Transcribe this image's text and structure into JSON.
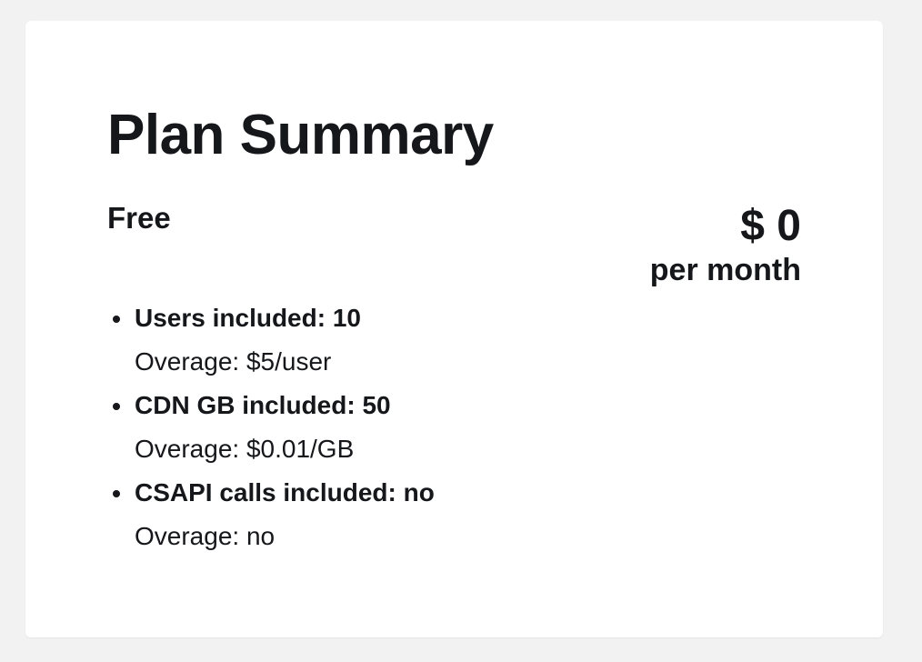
{
  "plan_summary": {
    "title": "Plan Summary",
    "plan_name": "Free",
    "price": {
      "amount": "$ 0",
      "period": "per month"
    },
    "features": [
      {
        "label": "Users included: 10",
        "overage": "Overage: $5/user"
      },
      {
        "label": "CDN GB included: 50",
        "overage": "Overage: $0.01/GB"
      },
      {
        "label": "CSAPI calls included: no",
        "overage": "Overage: no"
      }
    ]
  },
  "colors": {
    "page_background": "#f2f2f2",
    "card_background": "#ffffff",
    "text": "#16171b"
  }
}
